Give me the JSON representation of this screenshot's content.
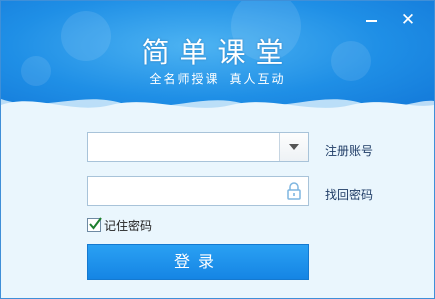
{
  "window": {
    "title": "简单课堂",
    "subtitle_left": "全名师授课",
    "subtitle_right": "真人互动",
    "minimize_label": "",
    "close_label": "✕"
  },
  "form": {
    "account_value": "",
    "password_value": "",
    "register_label": "注册账号",
    "find_password_label": "找回密码",
    "remember_label": "记住密码",
    "remember_checked": true,
    "login_label": "登录"
  },
  "colors": {
    "header": "#1f8fe6",
    "button": "#1a8ae8",
    "link": "#1f3c66"
  },
  "icons": [
    "chevron-down-icon",
    "lock-icon",
    "checkmark-icon",
    "minimize-icon",
    "close-icon"
  ]
}
